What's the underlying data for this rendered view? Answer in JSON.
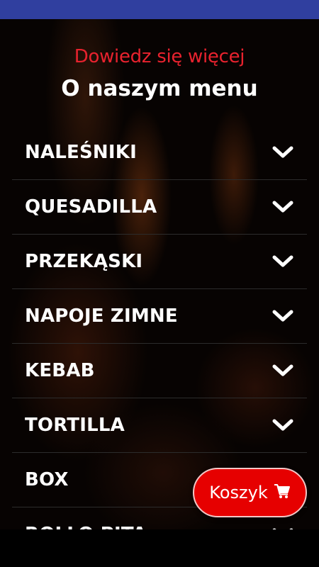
{
  "header": {
    "subtitle": "Dowiedz się więcej",
    "title": "O naszym menu"
  },
  "menu": {
    "items": [
      {
        "label": "NALEŚNIKI",
        "icon": "chevron-down-icon"
      },
      {
        "label": "QUESADILLA",
        "icon": "chevron-down-icon"
      },
      {
        "label": "PRZEKĄSKI",
        "icon": "chevron-down-icon"
      },
      {
        "label": "NAPOJE ZIMNE",
        "icon": "chevron-down-icon"
      },
      {
        "label": "KEBAB",
        "icon": "chevron-down-icon"
      },
      {
        "label": "TORTILLA",
        "icon": "chevron-down-icon"
      },
      {
        "label": "BOX",
        "icon": "chevron-down-icon"
      },
      {
        "label": "ROLLO PITA",
        "icon": "chevron-down-icon"
      }
    ]
  },
  "cart_button": {
    "label": "Koszyk",
    "icon": "cart-icon"
  },
  "colors": {
    "status_bar": "#303f9f",
    "accent": "#e8222e",
    "cart_button": "#e60000",
    "text": "#ffffff"
  }
}
